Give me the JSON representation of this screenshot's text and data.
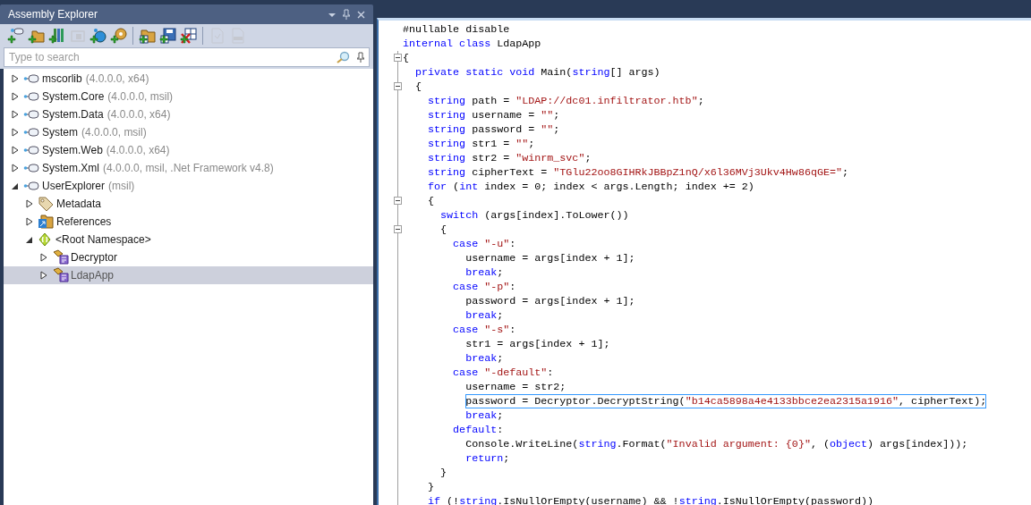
{
  "panel": {
    "title": "Assembly Explorer"
  },
  "toolbar": [
    {
      "kind": "add-node",
      "disabled": false
    },
    {
      "kind": "add-folder",
      "disabled": false
    },
    {
      "kind": "add-books",
      "disabled": false
    },
    {
      "kind": "open-frame",
      "disabled": true
    },
    {
      "kind": "add-globe",
      "disabled": false
    },
    {
      "kind": "add-gear",
      "disabled": false
    },
    {
      "kind": "separator"
    },
    {
      "kind": "folder-grid",
      "disabled": false
    },
    {
      "kind": "save-grid",
      "disabled": false
    },
    {
      "kind": "delete-grid",
      "disabled": false
    },
    {
      "kind": "separator"
    },
    {
      "kind": "doc-file",
      "disabled": true
    },
    {
      "kind": "pdb-file",
      "disabled": true
    }
  ],
  "search": {
    "placeholder": "Type to search"
  },
  "tree": [
    {
      "kind": "assembly",
      "name": "mscorlib",
      "detail": "(4.0.0.0, x64)",
      "expanded": false,
      "selected": false
    },
    {
      "kind": "assembly",
      "name": "System.Core",
      "detail": "(4.0.0.0, msil)",
      "expanded": false,
      "selected": false
    },
    {
      "kind": "assembly",
      "name": "System.Data",
      "detail": "(4.0.0.0, x64)",
      "expanded": false,
      "selected": false
    },
    {
      "kind": "assembly",
      "name": "System",
      "detail": "(4.0.0.0, msil)",
      "expanded": false,
      "selected": false
    },
    {
      "kind": "assembly",
      "name": "System.Web",
      "detail": "(4.0.0.0, x64)",
      "expanded": false,
      "selected": false
    },
    {
      "kind": "assembly",
      "name": "System.Xml",
      "detail": "(4.0.0.0, msil, .Net Framework v4.8)",
      "expanded": false,
      "selected": false
    },
    {
      "kind": "assembly",
      "name": "UserExplorer",
      "detail": "(msil)",
      "expanded": true,
      "selected": false,
      "children": [
        {
          "kind": "metadata",
          "name": "Metadata",
          "expanded": false,
          "selected": false
        },
        {
          "kind": "references",
          "name": "References",
          "expanded": false,
          "selected": false
        },
        {
          "kind": "namespace",
          "name": "<Root Namespace>",
          "expanded": true,
          "selected": false,
          "children": [
            {
              "kind": "class",
              "name": "Decryptor",
              "expanded": false,
              "selected": false
            },
            {
              "kind": "class",
              "name": "LdapApp",
              "expanded": false,
              "selected": true
            }
          ]
        }
      ]
    }
  ],
  "code": [
    {
      "fold": false,
      "selected": false,
      "segments": [
        {
          "kind": "text",
          "text": "#nullable disable"
        }
      ]
    },
    {
      "fold": false,
      "selected": false,
      "segments": [
        {
          "kind": "keyword",
          "text": "internal class"
        },
        {
          "kind": "text",
          "text": " LdapApp"
        }
      ]
    },
    {
      "fold": true,
      "selected": false,
      "segments": [
        {
          "kind": "text",
          "text": "{"
        }
      ]
    },
    {
      "fold": false,
      "selected": false,
      "segments": [
        {
          "kind": "keyword",
          "text": "  private static void"
        },
        {
          "kind": "text",
          "text": " Main("
        },
        {
          "kind": "keyword",
          "text": "string"
        },
        {
          "kind": "text",
          "text": "[] args)"
        }
      ]
    },
    {
      "fold": true,
      "selected": false,
      "segments": [
        {
          "kind": "text",
          "text": "  {"
        }
      ]
    },
    {
      "fold": false,
      "selected": false,
      "segments": [
        {
          "kind": "keyword",
          "text": "    string"
        },
        {
          "kind": "text",
          "text": " path = "
        },
        {
          "kind": "string",
          "text": "\"LDAP://dc01.infiltrator.htb\""
        },
        {
          "kind": "text",
          "text": ";"
        }
      ]
    },
    {
      "fold": false,
      "selected": false,
      "segments": [
        {
          "kind": "keyword",
          "text": "    string"
        },
        {
          "kind": "text",
          "text": " username = "
        },
        {
          "kind": "string",
          "text": "\"\""
        },
        {
          "kind": "text",
          "text": ";"
        }
      ]
    },
    {
      "fold": false,
      "selected": false,
      "segments": [
        {
          "kind": "keyword",
          "text": "    string"
        },
        {
          "kind": "text",
          "text": " password = "
        },
        {
          "kind": "string",
          "text": "\"\""
        },
        {
          "kind": "text",
          "text": ";"
        }
      ]
    },
    {
      "fold": false,
      "selected": false,
      "segments": [
        {
          "kind": "keyword",
          "text": "    string"
        },
        {
          "kind": "text",
          "text": " str1 = "
        },
        {
          "kind": "string",
          "text": "\"\""
        },
        {
          "kind": "text",
          "text": ";"
        }
      ]
    },
    {
      "fold": false,
      "selected": false,
      "segments": [
        {
          "kind": "keyword",
          "text": "    string"
        },
        {
          "kind": "text",
          "text": " str2 = "
        },
        {
          "kind": "string",
          "text": "\"winrm_svc\""
        },
        {
          "kind": "text",
          "text": ";"
        }
      ]
    },
    {
      "fold": false,
      "selected": false,
      "segments": [
        {
          "kind": "keyword",
          "text": "    string"
        },
        {
          "kind": "text",
          "text": " cipherText = "
        },
        {
          "kind": "string",
          "text": "\"TGlu22oo8GIHRkJBBpZ1nQ/x6l36MVj3Ukv4Hw86qGE=\""
        },
        {
          "kind": "text",
          "text": ";"
        }
      ]
    },
    {
      "fold": false,
      "selected": false,
      "segments": [
        {
          "kind": "keyword",
          "text": "    for"
        },
        {
          "kind": "text",
          "text": " ("
        },
        {
          "kind": "keyword",
          "text": "int"
        },
        {
          "kind": "text",
          "text": " index = 0; index < args.Length; index += 2)"
        }
      ]
    },
    {
      "fold": true,
      "selected": false,
      "segments": [
        {
          "kind": "text",
          "text": "    {"
        }
      ]
    },
    {
      "fold": false,
      "selected": false,
      "segments": [
        {
          "kind": "keyword",
          "text": "      switch"
        },
        {
          "kind": "text",
          "text": " (args[index].ToLower())"
        }
      ]
    },
    {
      "fold": true,
      "selected": false,
      "segments": [
        {
          "kind": "text",
          "text": "      {"
        }
      ]
    },
    {
      "fold": false,
      "selected": false,
      "segments": [
        {
          "kind": "keyword",
          "text": "        case"
        },
        {
          "kind": "string",
          "text": " \"-u\""
        },
        {
          "kind": "text",
          "text": ":"
        }
      ]
    },
    {
      "fold": false,
      "selected": false,
      "segments": [
        {
          "kind": "text",
          "text": "          username = args[index + 1];"
        }
      ]
    },
    {
      "fold": false,
      "selected": false,
      "segments": [
        {
          "kind": "keyword",
          "text": "          break"
        },
        {
          "kind": "text",
          "text": ";"
        }
      ]
    },
    {
      "fold": false,
      "selected": false,
      "segments": [
        {
          "kind": "keyword",
          "text": "        case"
        },
        {
          "kind": "string",
          "text": " \"-p\""
        },
        {
          "kind": "text",
          "text": ":"
        }
      ]
    },
    {
      "fold": false,
      "selected": false,
      "segments": [
        {
          "kind": "text",
          "text": "          password = args[index + 1];"
        }
      ]
    },
    {
      "fold": false,
      "selected": false,
      "segments": [
        {
          "kind": "keyword",
          "text": "          break"
        },
        {
          "kind": "text",
          "text": ";"
        }
      ]
    },
    {
      "fold": false,
      "selected": false,
      "segments": [
        {
          "kind": "keyword",
          "text": "        case"
        },
        {
          "kind": "string",
          "text": " \"-s\""
        },
        {
          "kind": "text",
          "text": ":"
        }
      ]
    },
    {
      "fold": false,
      "selected": false,
      "segments": [
        {
          "kind": "text",
          "text": "          str1 = args[index + 1];"
        }
      ]
    },
    {
      "fold": false,
      "selected": false,
      "segments": [
        {
          "kind": "keyword",
          "text": "          break"
        },
        {
          "kind": "text",
          "text": ";"
        }
      ]
    },
    {
      "fold": false,
      "selected": false,
      "segments": [
        {
          "kind": "keyword",
          "text": "        case"
        },
        {
          "kind": "string",
          "text": " \"-default\""
        },
        {
          "kind": "text",
          "text": ":"
        }
      ]
    },
    {
      "fold": false,
      "selected": false,
      "segments": [
        {
          "kind": "text",
          "text": "          username = str2;"
        }
      ]
    },
    {
      "fold": false,
      "selected": true,
      "segments": [
        {
          "kind": "text",
          "text": "          password = Decryptor.DecryptString("
        },
        {
          "kind": "string",
          "text": "\"b14ca5898a4e4133bbce2ea2315a1916\""
        },
        {
          "kind": "text",
          "text": ", cipherText);"
        }
      ]
    },
    {
      "fold": false,
      "selected": false,
      "segments": [
        {
          "kind": "keyword",
          "text": "          break"
        },
        {
          "kind": "text",
          "text": ";"
        }
      ]
    },
    {
      "fold": false,
      "selected": false,
      "segments": [
        {
          "kind": "keyword",
          "text": "        default"
        },
        {
          "kind": "text",
          "text": ":"
        }
      ]
    },
    {
      "fold": false,
      "selected": false,
      "segments": [
        {
          "kind": "text",
          "text": "          Console.WriteLine("
        },
        {
          "kind": "keyword",
          "text": "string"
        },
        {
          "kind": "text",
          "text": ".Format("
        },
        {
          "kind": "string",
          "text": "\"Invalid argument: {0}\""
        },
        {
          "kind": "text",
          "text": ", ("
        },
        {
          "kind": "keyword",
          "text": "object"
        },
        {
          "kind": "text",
          "text": ") args[index]));"
        }
      ]
    },
    {
      "fold": false,
      "selected": false,
      "segments": [
        {
          "kind": "keyword",
          "text": "          return"
        },
        {
          "kind": "text",
          "text": ";"
        }
      ]
    },
    {
      "fold": false,
      "selected": false,
      "segments": [
        {
          "kind": "text",
          "text": "      }"
        }
      ]
    },
    {
      "fold": false,
      "selected": false,
      "segments": [
        {
          "kind": "text",
          "text": "    }"
        }
      ]
    },
    {
      "fold": false,
      "selected": false,
      "segments": [
        {
          "kind": "keyword",
          "text": "    if"
        },
        {
          "kind": "text",
          "text": " (!"
        },
        {
          "kind": "keyword",
          "text": "string"
        },
        {
          "kind": "text",
          "text": ".IsNullOrEmpty(username) && !"
        },
        {
          "kind": "keyword",
          "text": "string"
        },
        {
          "kind": "text",
          "text": ".IsNullOrEmpty(password))"
        }
      ]
    }
  ]
}
